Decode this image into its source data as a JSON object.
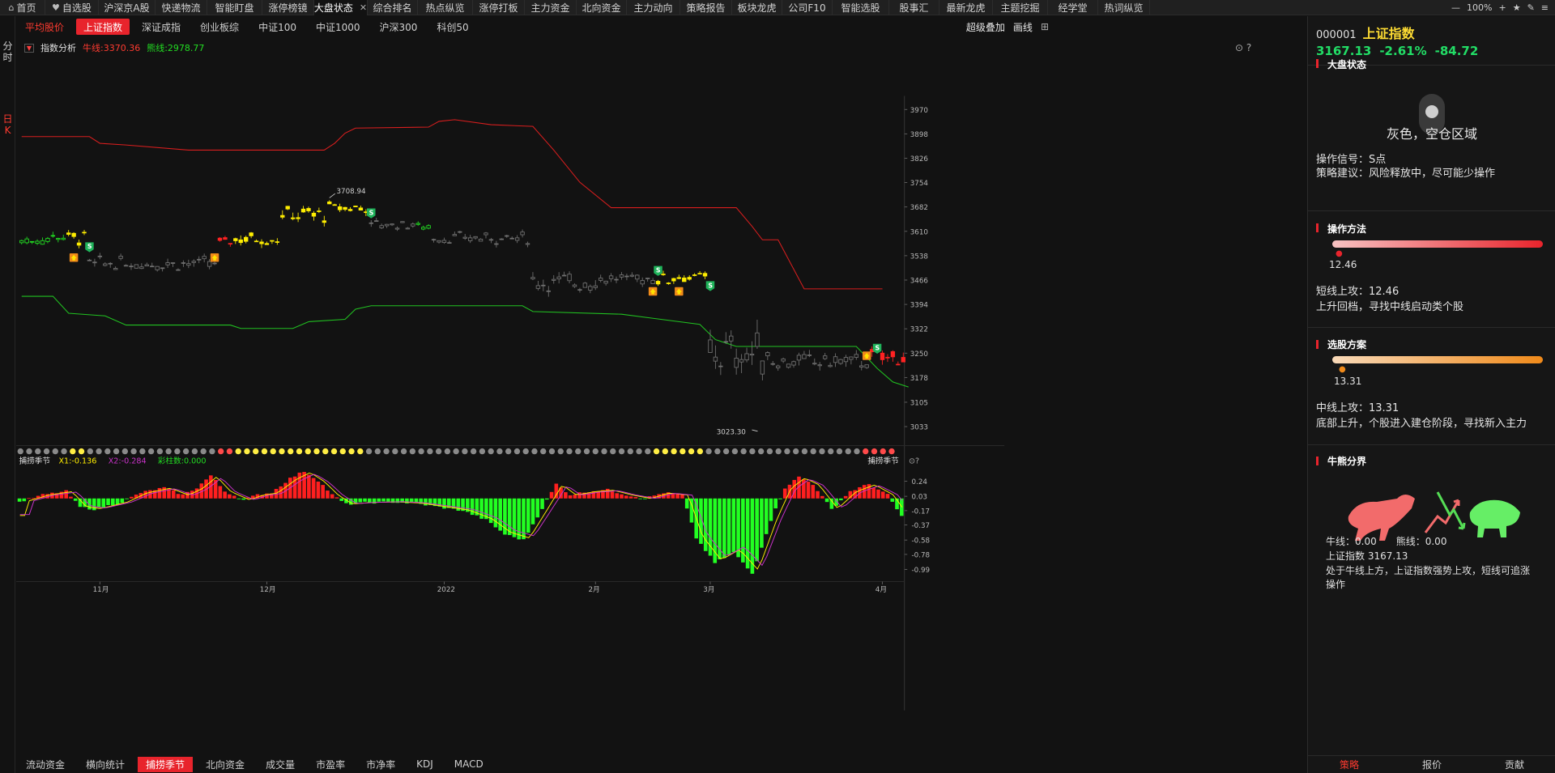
{
  "topnav": {
    "items": [
      {
        "label": "首页",
        "icon": "home-icon",
        "glyph": "⌂"
      },
      {
        "label": "自选股",
        "icon": "heart-icon",
        "glyph": "♥"
      },
      {
        "label": "沪深京A股"
      },
      {
        "label": "快递物流"
      },
      {
        "label": "智能盯盘"
      },
      {
        "label": "涨停榜镜"
      },
      {
        "label": "大盘状态",
        "active": true,
        "closable": true
      },
      {
        "label": "综合排名"
      },
      {
        "label": "热点纵览"
      },
      {
        "label": "涨停打板"
      },
      {
        "label": "主力资金"
      },
      {
        "label": "北向资金"
      },
      {
        "label": "主力动向"
      },
      {
        "label": "策略报告"
      },
      {
        "label": "板块龙虎"
      },
      {
        "label": "公司F10"
      },
      {
        "label": "智能选股"
      },
      {
        "label": "股事汇"
      },
      {
        "label": "最新龙虎"
      },
      {
        "label": "主题挖掘"
      },
      {
        "label": "经学堂"
      },
      {
        "label": "热词纵览"
      }
    ],
    "zoom": "100%",
    "close_glyph": "✕"
  },
  "leftstrip": {
    "tab1": "分时",
    "tab2": "日K"
  },
  "subtabs": {
    "items": [
      "平均股价",
      "上证指数",
      "深证成指",
      "创业板综",
      "中证100",
      "中证1000",
      "沪深300",
      "科创50"
    ],
    "active_index": 1
  },
  "toolbar_right": {
    "overlay": "超级叠加",
    "draw": "画线"
  },
  "indicator_header": {
    "name": "指数分析",
    "bull": "牛线:3370.36",
    "bear": "熊线:2978.77"
  },
  "sub_indicator_header": {
    "name": "捕捞季节",
    "x1": "X1:-0.136",
    "x2": "X2:-0.284",
    "bar": "彩柱数:0.000",
    "right_label": "捕捞季节"
  },
  "colors": {
    "up": "#ff2222",
    "down": "#22dd22",
    "signal_yellow": "#ffee00",
    "flat": "#707070",
    "accent": "#e8242c",
    "bg": "#121212"
  },
  "chart_data": {
    "type": "candlestick",
    "main_y_ticks": [
      "3970",
      "3898",
      "3826",
      "3754",
      "3682",
      "3610",
      "3538",
      "3466",
      "3394",
      "3322",
      "3250",
      "3178",
      "3105",
      "3033"
    ],
    "ylim": [
      2985,
      4010
    ],
    "x_ticks": [
      {
        "label": "11月",
        "index": 15
      },
      {
        "label": "12月",
        "index": 47
      },
      {
        "label": "2022",
        "index": 81
      },
      {
        "label": "2月",
        "index": 110
      },
      {
        "label": "3月",
        "index": 132
      },
      {
        "label": "4月",
        "index": 165
      }
    ],
    "n_candles": 170,
    "segments": [
      {
        "from": 0,
        "to": 2,
        "trend": 3582,
        "amp": 14,
        "color": "green"
      },
      {
        "from": 3,
        "to": 5,
        "trend": 3585,
        "amp": 12,
        "color": "green"
      },
      {
        "from": 6,
        "to": 8,
        "trend": 3596,
        "amp": 14,
        "color": "green"
      },
      {
        "from": 9,
        "to": 12,
        "trend": 3592,
        "amp": 18,
        "color": "yellow"
      },
      {
        "from": 13,
        "to": 37,
        "trend": 3515,
        "amp": 16,
        "color": "gray"
      },
      {
        "from": 38,
        "to": 40,
        "trend": 3580,
        "amp": 10,
        "color": "red"
      },
      {
        "from": 41,
        "to": 49,
        "trend": 3590,
        "amp": 18,
        "color": "yellow"
      },
      {
        "from": 50,
        "to": 58,
        "trend": 3660,
        "amp": 20,
        "color": "yellow"
      },
      {
        "from": 59,
        "to": 66,
        "trend": 3680,
        "amp": 14,
        "color": "yellow"
      },
      {
        "from": 67,
        "to": 75,
        "trend": 3630,
        "amp": 12,
        "color": "gray"
      },
      {
        "from": 76,
        "to": 78,
        "trend": 3624,
        "amp": 10,
        "color": "green"
      },
      {
        "from": 79,
        "to": 97,
        "trend": 3590,
        "amp": 14,
        "color": "gray"
      },
      {
        "from": 98,
        "to": 110,
        "trend": 3460,
        "amp": 22,
        "color": "gray"
      },
      {
        "from": 111,
        "to": 121,
        "trend": 3470,
        "amp": 14,
        "color": "gray"
      },
      {
        "from": 122,
        "to": 124,
        "trend": 3470,
        "amp": 16,
        "color": "yellow"
      },
      {
        "from": 125,
        "to": 131,
        "trend": 3475,
        "amp": 12,
        "color": "yellow"
      },
      {
        "from": 132,
        "to": 143,
        "trend": 3250,
        "amp": 50,
        "color": "gray"
      },
      {
        "from": 144,
        "to": 162,
        "trend": 3225,
        "amp": 20,
        "color": "gray"
      },
      {
        "from": 163,
        "to": 169,
        "trend": 3240,
        "amp": 20,
        "color": "red"
      }
    ],
    "annotations": [
      {
        "text": "3708.94",
        "index": 59,
        "value": 3708.94
      },
      {
        "text": "3023.30",
        "index": 140,
        "value": 3023.3
      }
    ],
    "buy_markers": [
      10,
      37,
      121,
      126,
      162
    ],
    "sell_markers": [
      13,
      67,
      122,
      132,
      164
    ],
    "bull_line": [
      [
        0,
        3890
      ],
      [
        13,
        3890
      ],
      [
        15,
        3870
      ],
      [
        20,
        3865
      ],
      [
        32,
        3850
      ],
      [
        58,
        3850
      ],
      [
        60,
        3870
      ],
      [
        62,
        3900
      ],
      [
        64,
        3915
      ],
      [
        78,
        3918
      ],
      [
        80,
        3935
      ],
      [
        83,
        3940
      ],
      [
        90,
        3925
      ],
      [
        98,
        3920
      ],
      [
        102,
        3850
      ],
      [
        107,
        3755
      ],
      [
        113,
        3680
      ],
      [
        137,
        3680
      ],
      [
        140,
        3625
      ],
      [
        142,
        3585
      ],
      [
        145,
        3585
      ],
      [
        150,
        3440
      ],
      [
        165,
        3440
      ]
    ],
    "bear_line": [
      [
        0,
        3418
      ],
      [
        6,
        3418
      ],
      [
        9,
        3368
      ],
      [
        16,
        3360
      ],
      [
        20,
        3333
      ],
      [
        40,
        3333
      ],
      [
        42,
        3323
      ],
      [
        52,
        3323
      ],
      [
        55,
        3343
      ],
      [
        62,
        3350
      ],
      [
        64,
        3380
      ],
      [
        67,
        3390
      ],
      [
        96,
        3390
      ],
      [
        98,
        3373
      ],
      [
        115,
        3365
      ],
      [
        120,
        3355
      ],
      [
        130,
        3335
      ],
      [
        133,
        3290
      ],
      [
        137,
        3270
      ],
      [
        160,
        3270
      ],
      [
        164,
        3205
      ],
      [
        167,
        3165
      ],
      [
        170,
        3150
      ]
    ],
    "dots_row": "gray-mostly with yellow and red clusters",
    "sub_y_ticks": [
      "0.24",
      "0.03",
      "-0.17",
      "-0.37",
      "-0.58",
      "-0.78",
      "-0.99"
    ],
    "sub_ylim": [
      -1.1,
      0.42
    ],
    "sub_hist_knots": [
      [
        0,
        -0.05
      ],
      [
        5,
        0.05
      ],
      [
        10,
        0.1
      ],
      [
        13,
        -0.12
      ],
      [
        16,
        -0.15
      ],
      [
        22,
        -0.05
      ],
      [
        26,
        0.08
      ],
      [
        31,
        0.15
      ],
      [
        35,
        0.05
      ],
      [
        38,
        0.15
      ],
      [
        41,
        0.32
      ],
      [
        44,
        0.1
      ],
      [
        48,
        -0.02
      ],
      [
        51,
        0.05
      ],
      [
        54,
        0.08
      ],
      [
        58,
        0.28
      ],
      [
        61,
        0.38
      ],
      [
        64,
        0.25
      ],
      [
        67,
        0.05
      ],
      [
        70,
        -0.08
      ],
      [
        74,
        -0.06
      ],
      [
        80,
        -0.05
      ],
      [
        85,
        -0.07
      ],
      [
        90,
        -0.12
      ],
      [
        95,
        -0.17
      ],
      [
        100,
        -0.3
      ],
      [
        104,
        -0.5
      ],
      [
        108,
        -0.58
      ],
      [
        111,
        -0.25
      ],
      [
        115,
        0.2
      ],
      [
        118,
        0.05
      ],
      [
        122,
        0.1
      ],
      [
        126,
        0.12
      ],
      [
        130,
        0.05
      ],
      [
        134,
        0.0
      ],
      [
        138,
        0.08
      ],
      [
        142,
        0.05
      ],
      [
        145,
        -0.55
      ],
      [
        149,
        -0.9
      ],
      [
        153,
        -0.75
      ],
      [
        157,
        -1.05
      ],
      [
        161,
        -0.3
      ],
      [
        164,
        0.15
      ],
      [
        167,
        0.3
      ],
      [
        170,
        0.2
      ],
      [
        174,
        -0.15
      ],
      [
        178,
        0.1
      ],
      [
        182,
        0.2
      ],
      [
        186,
        0.05
      ],
      [
        189,
        -0.25
      ]
    ]
  },
  "bottabs": {
    "items": [
      "流动资金",
      "横向统计",
      "捕捞季节",
      "北向资金",
      "成交量",
      "市盈率",
      "市净率",
      "KDJ",
      "MACD"
    ],
    "active_index": 2
  },
  "rpanel": {
    "code": "000001",
    "name": "上证指数",
    "price": "3167.13",
    "pct": "-2.61%",
    "chg": "-84.72",
    "s1_title": "大盘状态",
    "status": "灰色，空仓区域",
    "signal": "操作信号：S点",
    "advice": "策略建议：风险释放中，尽可能少操作",
    "s2_title": "操作方法",
    "s2_value": "12.46",
    "s2_line1": "短线上攻：12.46",
    "s2_line2": "上升回档，寻找中线启动类个股",
    "s3_title": "选股方案",
    "s3_value": "13.31",
    "s3_line1": "中线上攻：13.31",
    "s3_line2": "底部上升，个股进入建仓阶段，寻找新入主力",
    "s4_title": "牛熊分界",
    "bull": "牛线：0.00",
    "bear": "熊线：0.00",
    "index_line": "上证指数 3167.13",
    "summary1": "处于牛线上方，上证指数强势上攻，短线可追涨",
    "summary2": "操作",
    "tabs": [
      "策略",
      "报价",
      "贡献"
    ],
    "active_tab": 0
  }
}
